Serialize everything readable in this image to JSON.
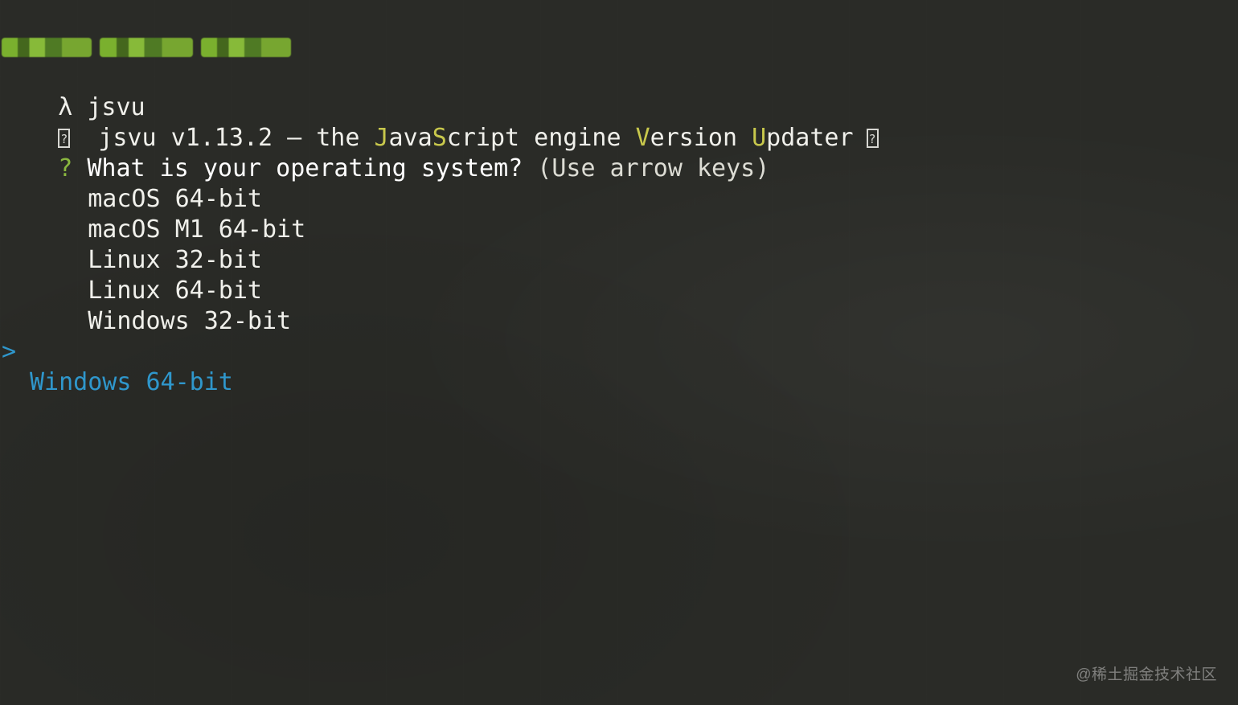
{
  "terminal": {
    "prompt": {
      "symbol": "λ",
      "command": "jsvu"
    },
    "banner": {
      "prefix": " jsvu v1.13.2 — the ",
      "java_initial": "J",
      "java_middle": "ava",
      "script_initial": "S",
      "script_rest": "cript engine ",
      "version_initial": "V",
      "version_rest": "ersion ",
      "updater_initial": "U",
      "updater_rest": "pdater"
    },
    "question": {
      "mark": "?",
      "text": " What is your operating system? ",
      "hint": "(Use arrow keys)"
    },
    "options": [
      {
        "label": "macOS 64-bit"
      },
      {
        "label": "macOS M1 64-bit"
      },
      {
        "label": "Linux 32-bit"
      },
      {
        "label": "Linux 64-bit"
      },
      {
        "label": "Windows 32-bit"
      },
      {
        "label": "Windows 64-bit",
        "selected": true
      }
    ],
    "selected_marker": ">",
    "watermark": "@稀土掘金技术社区"
  },
  "colors": {
    "background": "#2a2b27",
    "text": "#f0f0eb",
    "accent_green": "#8ab73f",
    "accent_yellow": "#c8c84c",
    "selection_blue": "#2f97cc"
  },
  "icons": {
    "banner_left": "placeholder-box-icon",
    "banner_right": "placeholder-box-icon",
    "redacted_path": "blurred-path-icon"
  }
}
